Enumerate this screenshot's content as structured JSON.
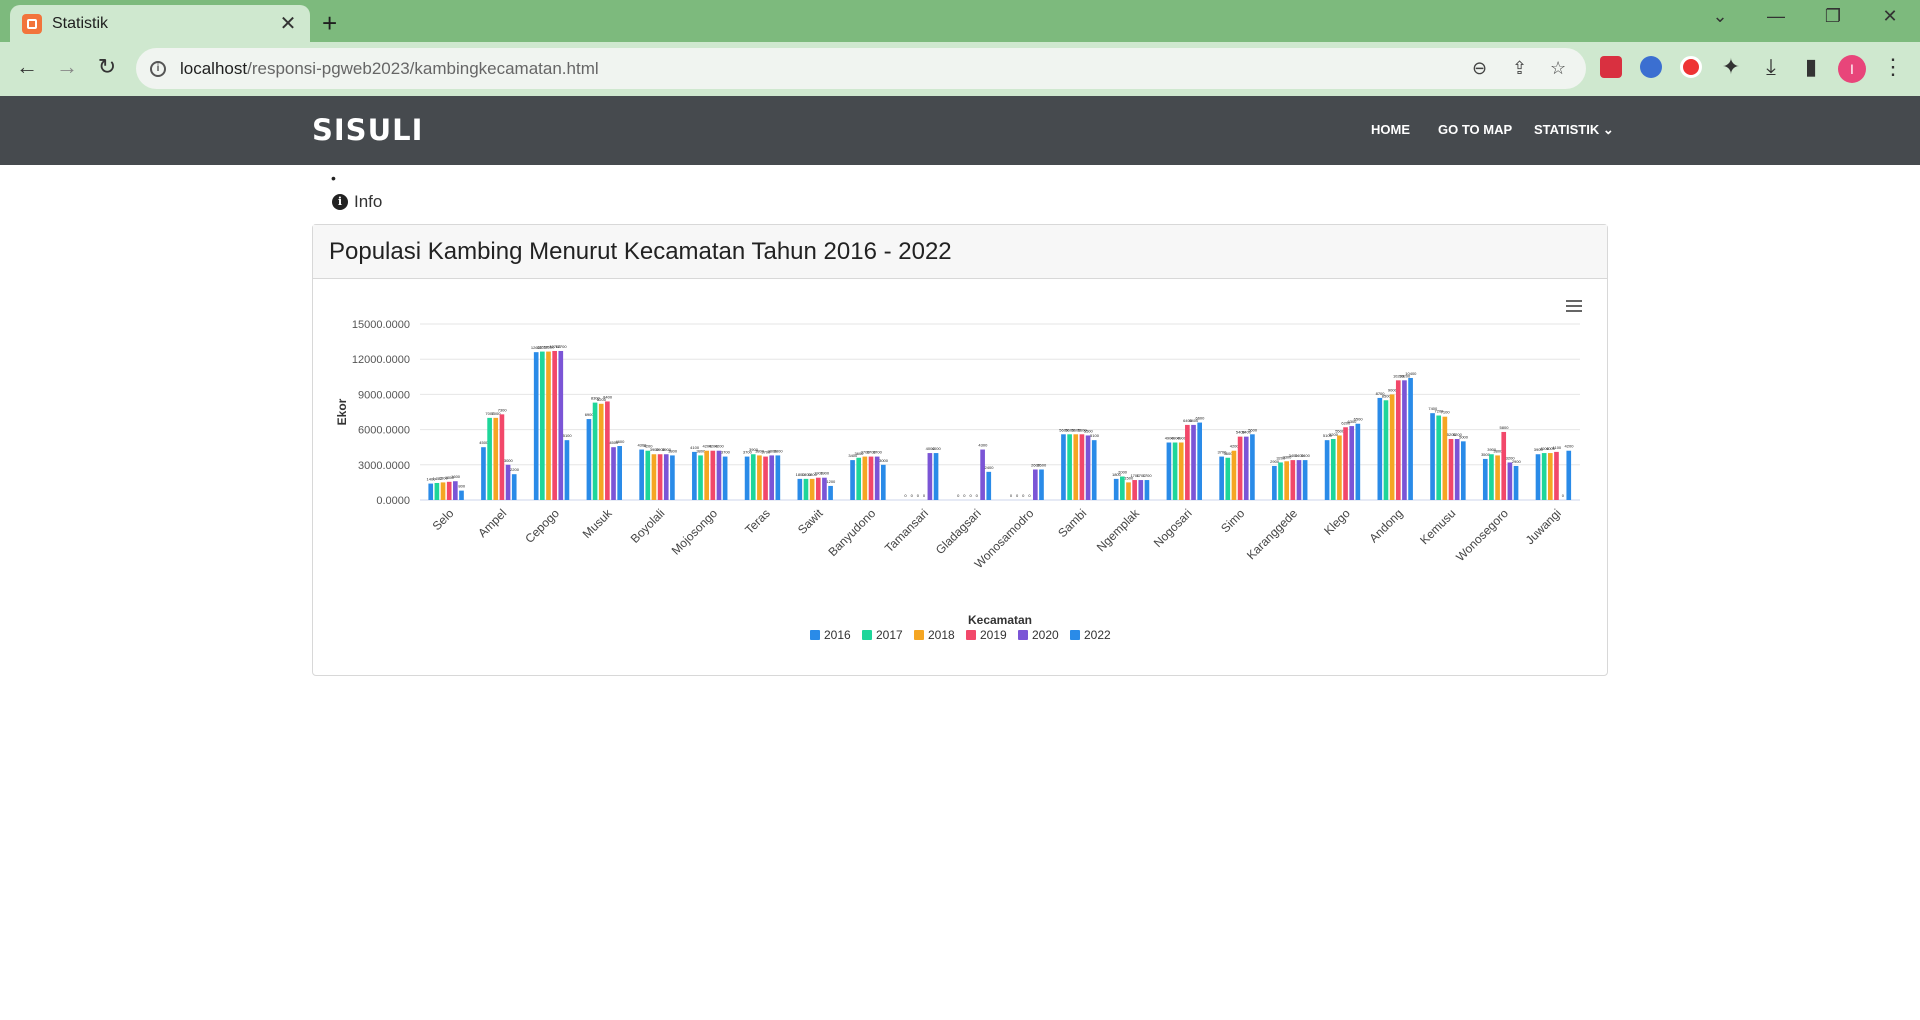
{
  "browser": {
    "tab_title": "Statistik",
    "url_host": "localhost",
    "url_path": "/responsi-pgweb2023/kambingkecamatan.html",
    "profile_initial": "I"
  },
  "navbar": {
    "brand": "SISULI",
    "links": [
      "HOME",
      "GO TO MAP",
      "STATISTIK"
    ]
  },
  "content": {
    "bullet": "•",
    "info_label": "Info",
    "card_title": "Populasi Kambing Menurut Kecamatan Tahun 2016 - 2022"
  },
  "colors": {
    "navbar_bg": "#464a4e",
    "tabbar_bg": "#7dba7d",
    "toolbar_bg": "#cfe8cf"
  },
  "chart_data": {
    "type": "bar",
    "xlabel": "Kecamatan",
    "ylabel": "Ekor",
    "ylim": [
      0,
      15000
    ],
    "yticks": [
      "0.0000",
      "3000.0000",
      "6000.0000",
      "9000.0000",
      "12000.0000",
      "15000.0000"
    ],
    "grid": true,
    "legend_position": "bottom-center",
    "categories": [
      "Selo",
      "Ampel",
      "Cepogo",
      "Musuk",
      "Boyolali",
      "Mojosongo",
      "Teras",
      "Sawit",
      "Banyudono",
      "Tamansari",
      "Gladagsari",
      "Wonosamodro",
      "Sambi",
      "Ngemplak",
      "Nogosari",
      "Simo",
      "Karanggede",
      "Klego",
      "Andong",
      "Kemusu",
      "Wonosegoro",
      "Juwangi"
    ],
    "series": [
      {
        "name": "2016",
        "color": "#2a8be8",
        "values": [
          1400,
          4500,
          12600,
          6900,
          4300,
          4100,
          3700,
          1800,
          3400,
          0,
          0,
          0,
          5600,
          1800,
          4900,
          3700,
          2900,
          5100,
          8700,
          7400,
          3500,
          3900
        ]
      },
      {
        "name": "2017",
        "color": "#1ed69a",
        "values": [
          1450,
          7000,
          12650,
          8300,
          4200,
          3800,
          3900,
          1800,
          3600,
          0,
          0,
          0,
          5600,
          2000,
          4900,
          3600,
          3200,
          5200,
          8500,
          7200,
          3900,
          4000
        ]
      },
      {
        "name": "2018",
        "color": "#f5a623",
        "values": [
          1500,
          7000,
          12650,
          8200,
          3900,
          4200,
          3800,
          1800,
          3700,
          0,
          0,
          0,
          5600,
          1500,
          4900,
          4200,
          3300,
          5500,
          9000,
          7100,
          3800,
          4000
        ]
      },
      {
        "name": "2019",
        "color": "#f2486a",
        "values": [
          1550,
          7300,
          12700,
          8400,
          3900,
          4200,
          3700,
          1900,
          3700,
          0,
          0,
          0,
          5600,
          1700,
          6400,
          5400,
          3400,
          6200,
          10200,
          5200,
          5800,
          4100
        ]
      },
      {
        "name": "2020",
        "color": "#7b55d6",
        "values": [
          1600,
          3000,
          12700,
          4500,
          3900,
          4200,
          3800,
          1900,
          3700,
          4000,
          4300,
          2600,
          5500,
          1700,
          6400,
          5400,
          3400,
          6300,
          10200,
          5200,
          3200,
          0
        ]
      },
      {
        "name": "2022",
        "color": "#2a8be8",
        "values": [
          800,
          2200,
          5100,
          4600,
          3800,
          3700,
          3800,
          1200,
          3000,
          4000,
          2400,
          2600,
          5100,
          1700,
          6600,
          5600,
          3400,
          6500,
          10400,
          5000,
          2900,
          4200
        ]
      }
    ]
  }
}
